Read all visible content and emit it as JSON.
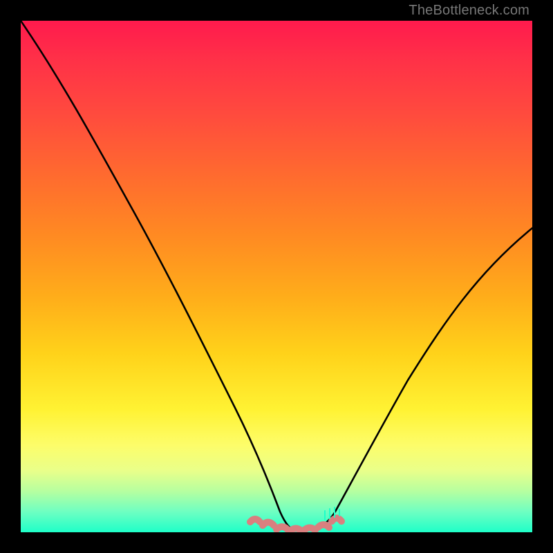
{
  "watermark": "TheBottleneck.com",
  "chart_data": {
    "type": "line",
    "title": "",
    "xlabel": "",
    "ylabel": "",
    "xlim": [
      0,
      100
    ],
    "ylim": [
      0,
      100
    ],
    "grid": false,
    "series": [
      {
        "name": "bottleneck-curve",
        "x": [
          0,
          6,
          12,
          18,
          24,
          30,
          36,
          40,
          44,
          48,
          52,
          55,
          58,
          62,
          68,
          75,
          82,
          90,
          100
        ],
        "values": [
          100,
          88,
          76,
          64,
          52,
          40,
          28,
          20,
          12,
          5,
          1,
          0,
          1,
          5,
          12,
          22,
          33,
          45,
          60
        ],
        "color": "#000000"
      }
    ],
    "annotations": [
      {
        "name": "bottom-dash-band",
        "x_range": [
          44,
          62
        ],
        "y": 0,
        "style": "pink-dashes"
      }
    ],
    "gradient_stops": [
      {
        "pos": 0.0,
        "color": "#ff1a4d"
      },
      {
        "pos": 0.18,
        "color": "#ff4a3e"
      },
      {
        "pos": 0.42,
        "color": "#ff8a22"
      },
      {
        "pos": 0.65,
        "color": "#ffd21a"
      },
      {
        "pos": 0.83,
        "color": "#fdfd6a"
      },
      {
        "pos": 0.96,
        "color": "#6effc2"
      },
      {
        "pos": 1.0,
        "color": "#1effc8"
      }
    ]
  }
}
